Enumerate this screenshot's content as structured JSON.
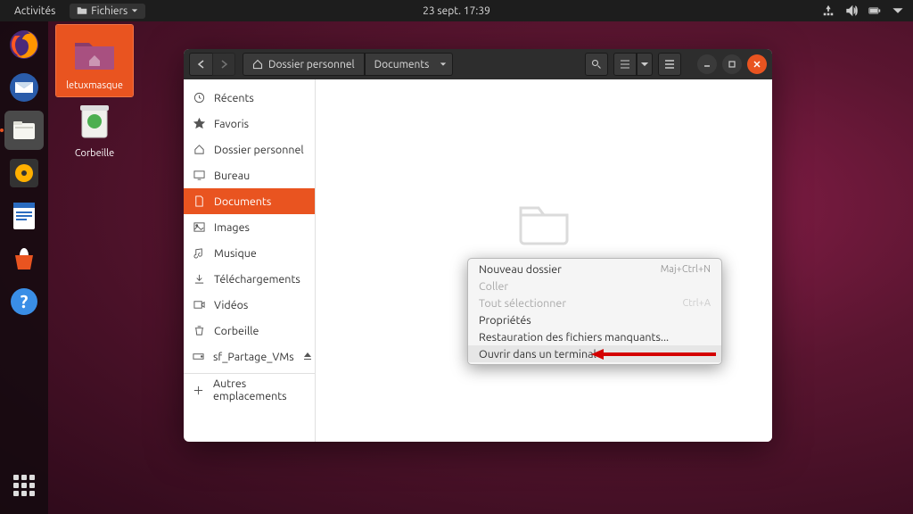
{
  "topbar": {
    "activities": "Activités",
    "appmenu": "Fichiers",
    "datetime": "23 sept.  17:39"
  },
  "desktop": {
    "icons": [
      {
        "name": "letuxmasque"
      },
      {
        "name": "Corbeille"
      }
    ]
  },
  "window": {
    "breadcrumb": {
      "home": "Dossier personnel",
      "current": "Documents"
    },
    "sidebar": {
      "recent": "Récents",
      "starred": "Favoris",
      "home": "Dossier personnel",
      "desktop": "Bureau",
      "documents": "Documents",
      "pictures": "Images",
      "music": "Musique",
      "downloads": "Téléchargements",
      "videos": "Vidéos",
      "trash": "Corbeille",
      "shared": "sf_Partage_VMs",
      "other": "Autres emplacements"
    }
  },
  "context_menu": {
    "items": [
      {
        "label": "Nouveau dossier",
        "shortcut": "Maj+Ctrl+N",
        "enabled": true
      },
      {
        "label": "Coller",
        "shortcut": "",
        "enabled": false
      },
      {
        "label": "Tout sélectionner",
        "shortcut": "Ctrl+A",
        "enabled": false
      },
      {
        "label": "Propriétés",
        "shortcut": "",
        "enabled": true
      },
      {
        "label": "Restauration des fichiers manquants...",
        "shortcut": "",
        "enabled": true
      },
      {
        "label": "Ouvrir dans un terminal",
        "shortcut": "",
        "enabled": true
      }
    ]
  }
}
